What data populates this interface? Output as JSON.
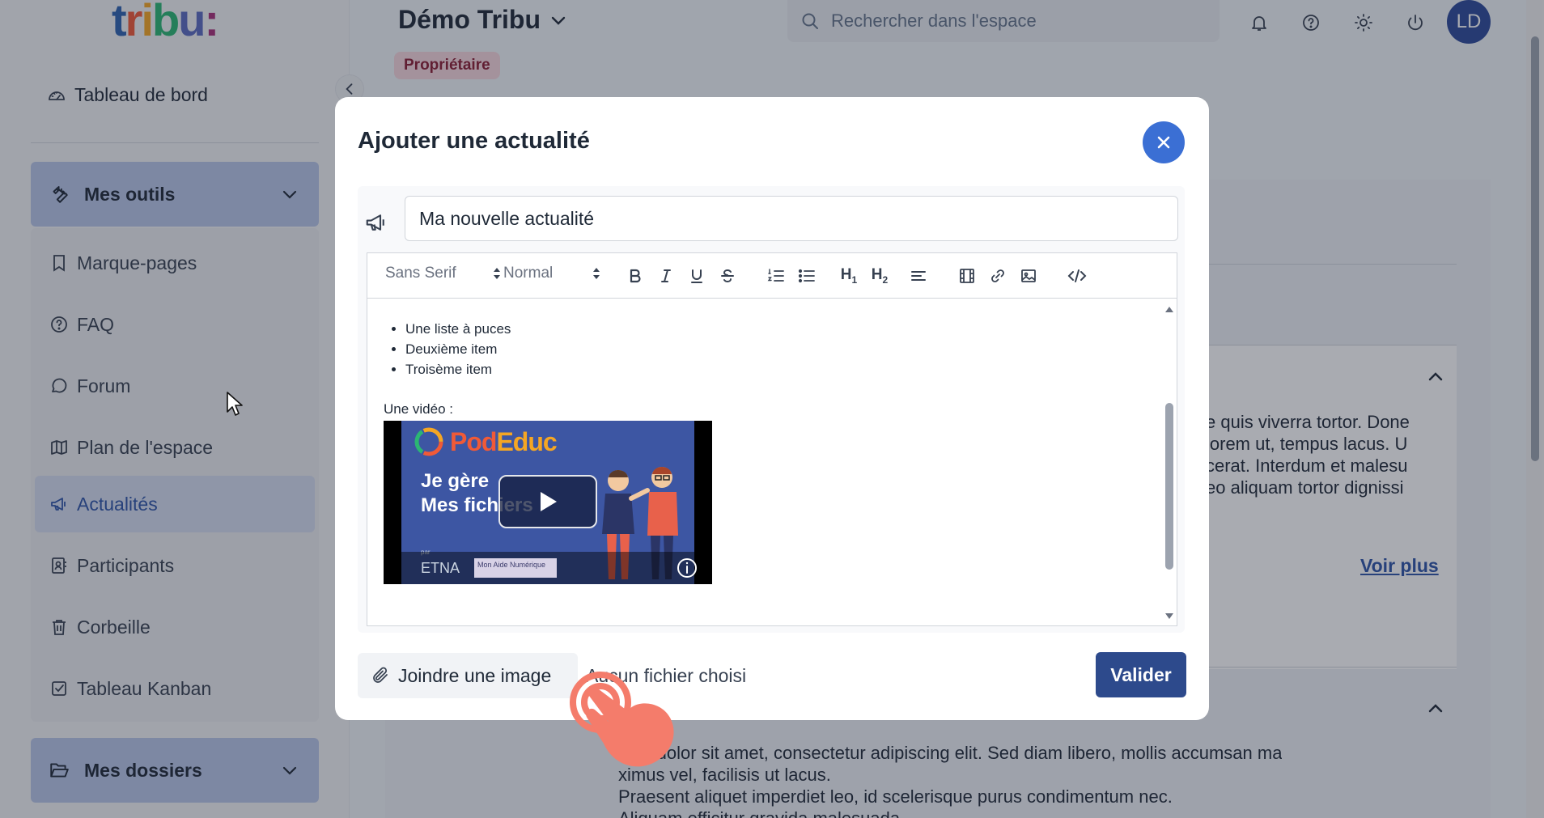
{
  "app": {
    "logo_text": "tribu:",
    "space_title": "Démo Tribu",
    "role_badge": "Propriétaire",
    "search_placeholder": "Rechercher dans l'espace",
    "user_initials": "LD"
  },
  "sidebar": {
    "dashboard_label": "Tableau de bord",
    "tools_section": "Mes outils",
    "items": [
      {
        "label": "Marque-pages",
        "icon": "bookmark-icon"
      },
      {
        "label": "FAQ",
        "icon": "question-icon"
      },
      {
        "label": "Forum",
        "icon": "chat-icon"
      },
      {
        "label": "Plan de l'espace",
        "icon": "map-icon"
      },
      {
        "label": "Actualités",
        "icon": "megaphone-icon",
        "active": true
      },
      {
        "label": "Participants",
        "icon": "contacts-icon"
      },
      {
        "label": "Corbeille",
        "icon": "trash-icon"
      },
      {
        "label": "Tableau Kanban",
        "icon": "checkbox-icon"
      }
    ],
    "folders_section": "Mes dossiers"
  },
  "background": {
    "text_lines_1": [
      "e quis viverra tortor. Done",
      "lorem ut, tempus lacus. U",
      "cerat. Interdum et malesu",
      "eo aliquam tortor dignissi"
    ],
    "voir_plus": "Voir plus",
    "text_lines_2": [
      "sum dolor sit amet, consectetur adipiscing elit. Sed diam libero, mollis accumsan ma",
      "ximus vel, facilisis ut lacus.",
      "Praesent aliquet imperdiet leo, id scelerisque purus condimentum nec.",
      "Aliquam efficitur gravida malesuada"
    ]
  },
  "modal": {
    "title": "Ajouter une actualité",
    "title_input_value": "Ma nouvelle actualité",
    "toolbar": {
      "font_select": "Sans Serif",
      "size_select": "Normal",
      "heading1": "H1",
      "heading2": "H2"
    },
    "content": {
      "list_items": [
        "Une liste à puces",
        "Deuxième item",
        "Troisème item"
      ],
      "video_label": "Une vidéo :",
      "video": {
        "brand_part1": "Pod",
        "brand_part2": "Educ",
        "line1": "Je gère",
        "line2": "Mes fichiers",
        "by": "par",
        "etna": "ETNA",
        "aide": "Mon Aide Numérique"
      }
    },
    "attach_label": "Joindre une image",
    "no_file_text": "Aucun fichier choisi",
    "submit_label": "Valider"
  },
  "colors": {
    "accent": "#3b6fd4",
    "primary_dark": "#2d4a8c",
    "active_nav": "#2e54a8",
    "badge_bg": "#f7d7dd"
  }
}
